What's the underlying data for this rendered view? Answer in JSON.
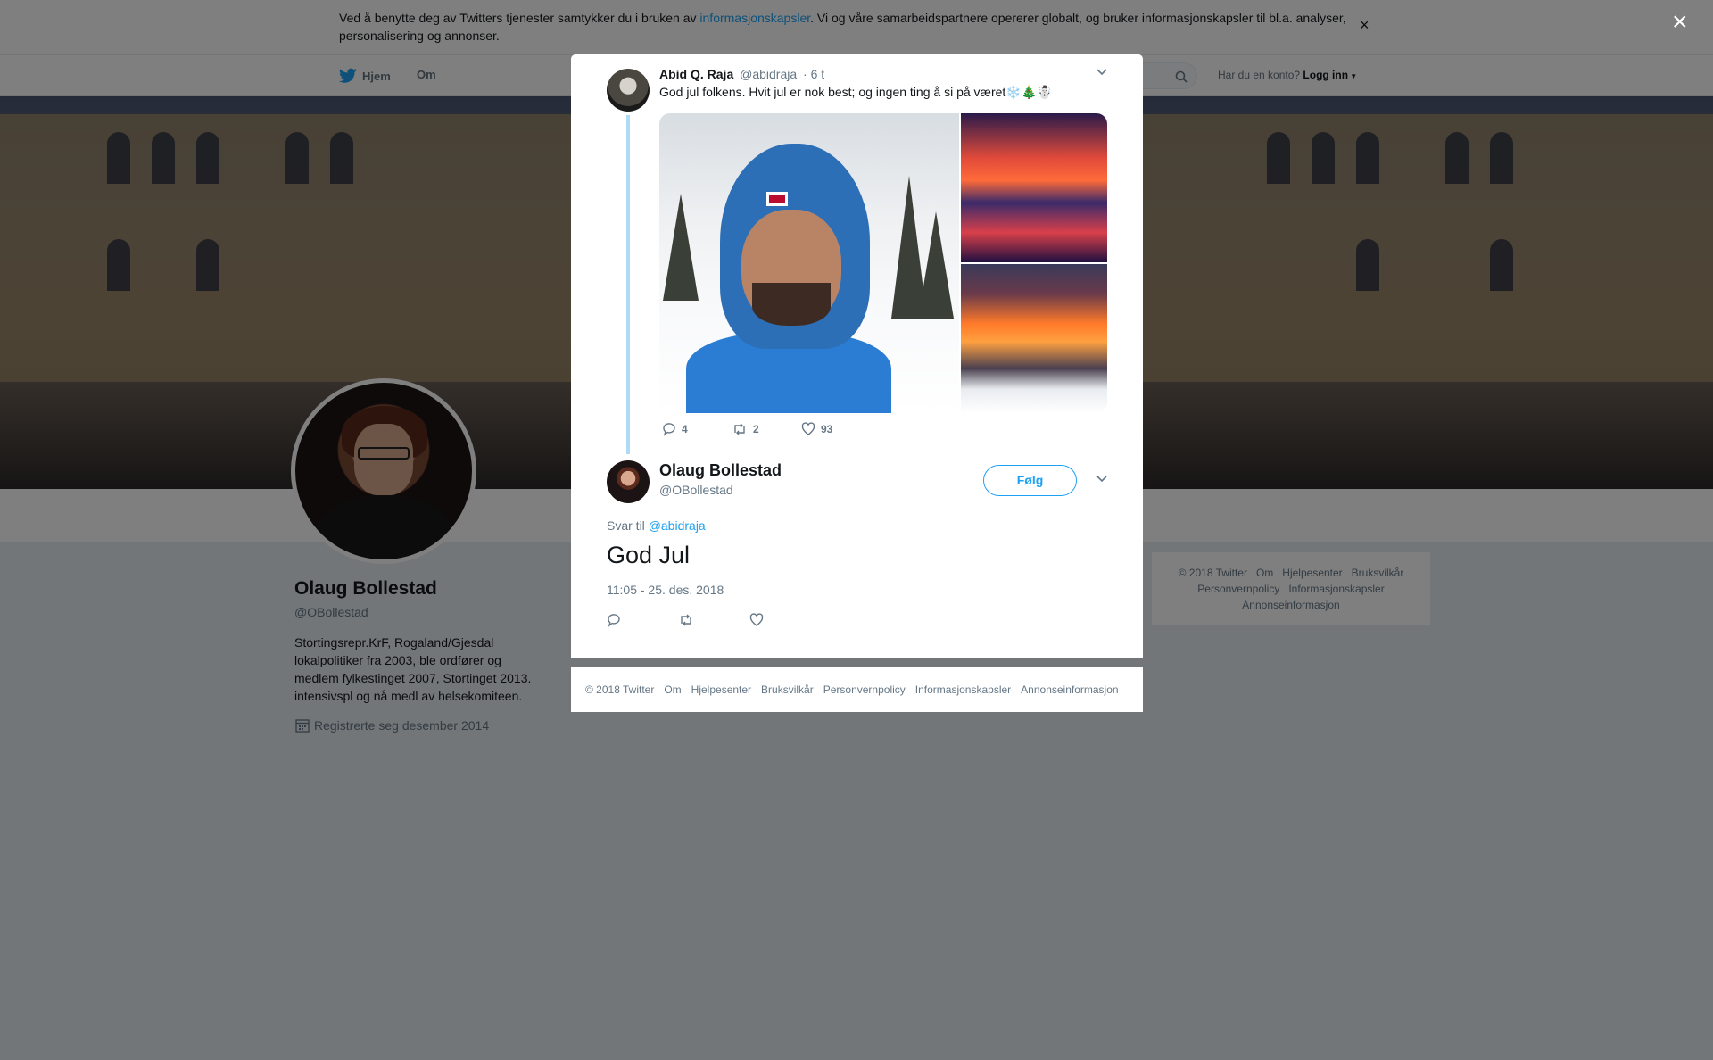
{
  "cookie_bar": {
    "text_before": "Ved å benytte deg av Twitters tjenester samtykker du i bruken av ",
    "link": "informasjonskapsler",
    "text_after": ". Vi og våre samarbeidspartnere opererer globalt, og bruker informasjonskapsler til bl.a. analyser, personalisering og annonser.",
    "close": "×"
  },
  "top_nav": {
    "home": "Hjem",
    "about": "Om",
    "account_prompt": "Har du en konto?",
    "login": "Logg inn"
  },
  "profile": {
    "name": "Olaug Bollestad",
    "handle": "@OBollestad",
    "bio": "Stortingsrepr.KrF, Rogaland/Gjesdal lokalpolitiker fra 2003, ble ordfører og medlem fylkestinget 2007, Stortinget 2013. intensivspl og nå medl av helsekomiteen.",
    "joined": "Registrerte seg desember 2014"
  },
  "side_footer": {
    "items": [
      "© 2018 Twitter",
      "Om",
      "Hjelpesenter",
      "Bruksvilkår",
      "Personvernpolicy",
      "Informasjonskapsler",
      "Annonseinformasjon"
    ]
  },
  "overlay": {
    "close": "×"
  },
  "parent_tweet": {
    "name": "Abid Q. Raja",
    "handle": "@abidraja",
    "time": "· 6 t",
    "text": "God jul folkens. Hvit jul er nok best; og ingen ting å si på været❄️🎄☃️",
    "replies": "4",
    "retweets": "2",
    "likes": "93"
  },
  "main_tweet": {
    "name": "Olaug Bollestad",
    "handle": "@OBollestad",
    "follow": "Følg",
    "reply_prefix": "Svar til",
    "reply_handle": "@abidraja",
    "text": "God Jul",
    "timestamp": "11:05 - 25. des. 2018"
  },
  "modal_footer": {
    "items": [
      "© 2018 Twitter",
      "Om",
      "Hjelpesenter",
      "Bruksvilkår",
      "Personvernpolicy",
      "Informasjonskapsler",
      "Annonseinformasjon"
    ]
  },
  "colors": {
    "accent": "#1da1f2",
    "thread_line": "#aedcf7",
    "secondary_text": "#657786"
  }
}
